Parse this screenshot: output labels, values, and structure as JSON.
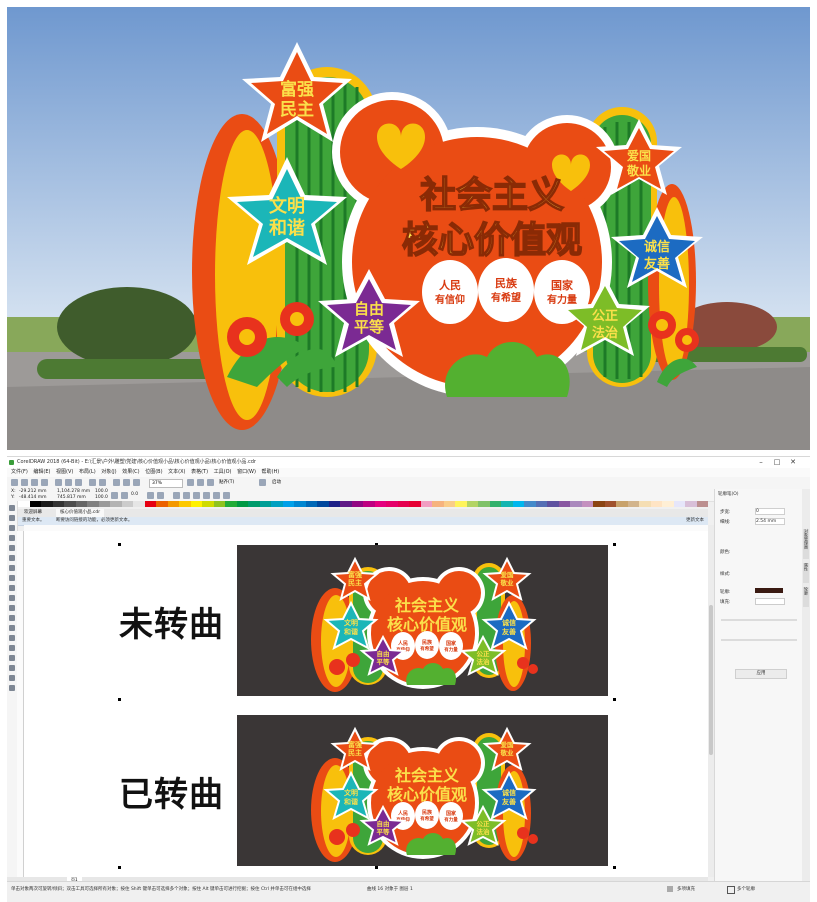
{
  "window": {
    "title": "CorelDRAW 2018 (64-Bit) - E:\\汇景\\户外\\雕塑\\党建\\核心价值观小品\\核心价值观小品\\核心价值观小品.cdr",
    "minimize": "–",
    "maximize": "□",
    "close": "✕"
  },
  "menu": [
    "文件(F)",
    "编辑(E)",
    "视图(V)",
    "布局(L)",
    "对象(J)",
    "效果(C)",
    "位图(B)",
    "文本(X)",
    "表格(T)",
    "工具(O)",
    "窗口(W)",
    "帮助(H)"
  ],
  "propbar": {
    "x": "-29.212 mm",
    "y": "-48.414 mm",
    "w": "1,104.278 mm",
    "h": "745.817 mm",
    "scale_w": "100.0",
    "scale_h": "100.0",
    "angle": "0.0",
    "zoom": "37%",
    "snap": "贴齐(T)",
    "launch": "启动"
  },
  "tabs": {
    "welcome": "欢迎屏幕",
    "doc": "核心价值观小品.cdr",
    "hint": "重要文本。",
    "hint_detail": "断要访问链接的功能，必须更新文本。",
    "update": "更新文本"
  },
  "canvas": {
    "label_unconverted": "未转曲",
    "label_converted": "已转曲"
  },
  "art": {
    "title_line1": "社会主义",
    "title_line2": "核心价值观",
    "stars": [
      {
        "l1": "富强",
        "l2": "民主"
      },
      {
        "l1": "文明",
        "l2": "和谐"
      },
      {
        "l1": "自由",
        "l2": "平等"
      },
      {
        "l1": "爱国",
        "l2": "敬业"
      },
      {
        "l1": "诚信",
        "l2": "友善"
      },
      {
        "l1": "公正",
        "l2": "法治"
      }
    ],
    "eggs": [
      {
        "l1": "人民",
        "l2": "有信仰"
      },
      {
        "l1": "民族",
        "l2": "有希望"
      },
      {
        "l1": "国家",
        "l2": "有力量"
      }
    ]
  },
  "docker": {
    "title": "轮廓笔(O)",
    "width_label": "步宽:",
    "width_value": "0",
    "size_label": "细线:",
    "size_value": "2.54 mm",
    "color_label": "颜色:",
    "style_label": "样式:",
    "outline_label": "轮廓:",
    "fill_label": "填充:",
    "side_tab1": "对象管理器",
    "side_tab2": "属性",
    "side_tab3": "轮廓",
    "apply": "应用"
  },
  "pages": {
    "page1": "页1"
  },
  "status": {
    "hint": "单击对象两次可旋转/倾斜；双击工具可选择所有对象；按住 Shift 键单击可选择多个对象；按住 Alt 键单击可进行挖掘；按住 Ctrl 并单击可在组中选择",
    "center": "曲线 16 对象于 图层 1",
    "fill": "多项填充",
    "outline": "多个轮廓"
  },
  "colors": {
    "sky_top": "#6f98cf",
    "sky_bottom": "#d9e5f2",
    "orange": "#ea4c14",
    "yellow": "#f8c00c",
    "green": "#3ea53a",
    "art_bg": "#3a3636"
  }
}
